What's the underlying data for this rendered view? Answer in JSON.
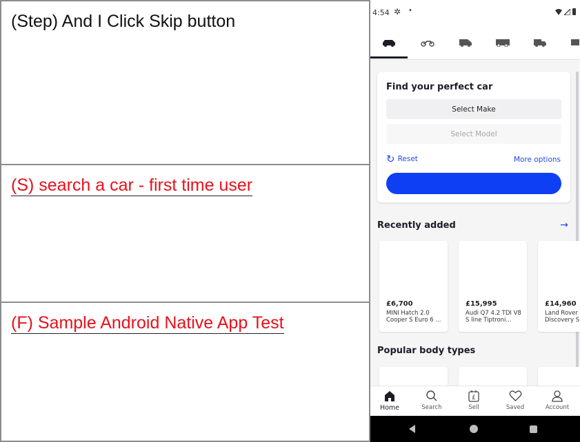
{
  "report": {
    "step": "(Step) And I Click Skip button",
    "scenario": "(S) search a car - first time user",
    "feature": "(F) Sample Android Native App Test"
  },
  "phone": {
    "status_time": "4:54",
    "status_icons": [
      "gear-icon",
      "dot-icon",
      "wifi-icon",
      "signal-icon",
      "battery-icon"
    ],
    "vehicle_tabs": [
      "car-icon",
      "motorbike-icon",
      "van-icon",
      "motorhome-icon",
      "truck-icon",
      "more-vehicle-icon"
    ],
    "search_card": {
      "title": "Find your perfect car",
      "make_label": "Select Make",
      "model_label": "Select Model",
      "reset_label": "Reset",
      "more_options_label": "More options",
      "search_button_color": "#0f3ff5"
    },
    "recently_added": {
      "title": "Recently added",
      "arrow": "→",
      "cars": [
        {
          "price": "£6,700",
          "name": "MINI Hatch 2.0 Cooper S Euro 6 ..."
        },
        {
          "price": "£15,995",
          "name": "Audi Q7 4.2 TDI V8 S line Tiptroni..."
        },
        {
          "price": "£14,960",
          "name": "Land Rover Discovery S"
        }
      ]
    },
    "popular": {
      "title": "Popular body types"
    },
    "bottom_nav": [
      {
        "label": "Home",
        "icon": "home-icon"
      },
      {
        "label": "Search",
        "icon": "search-icon"
      },
      {
        "label": "Sell",
        "icon": "sell-icon"
      },
      {
        "label": "Saved",
        "icon": "heart-icon"
      },
      {
        "label": "Account",
        "icon": "account-icon"
      }
    ],
    "accent_color": "#2249e8"
  }
}
